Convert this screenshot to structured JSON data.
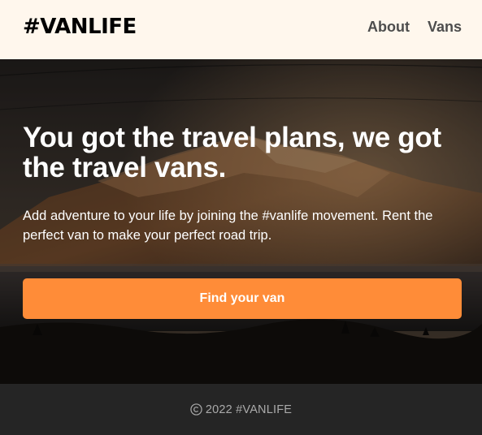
{
  "header": {
    "logo": "#VANLIFE",
    "nav": [
      {
        "label": "About"
      },
      {
        "label": "Vans"
      }
    ]
  },
  "hero": {
    "title": "You got the travel plans, we got the travel vans.",
    "text": "Add adventure to your life by joining the #vanlife movement. Rent the perfect van to make your perfect road trip.",
    "button_label": "Find your van",
    "background_icon": "mountain-lake-photo"
  },
  "footer": {
    "icon": "copyright-icon",
    "text": "2022 #VANLIFE"
  },
  "colors": {
    "header_bg": "#fff7ed",
    "accent": "#ff8c38",
    "footer_bg": "#252525",
    "footer_text": "#aaaaaa"
  }
}
